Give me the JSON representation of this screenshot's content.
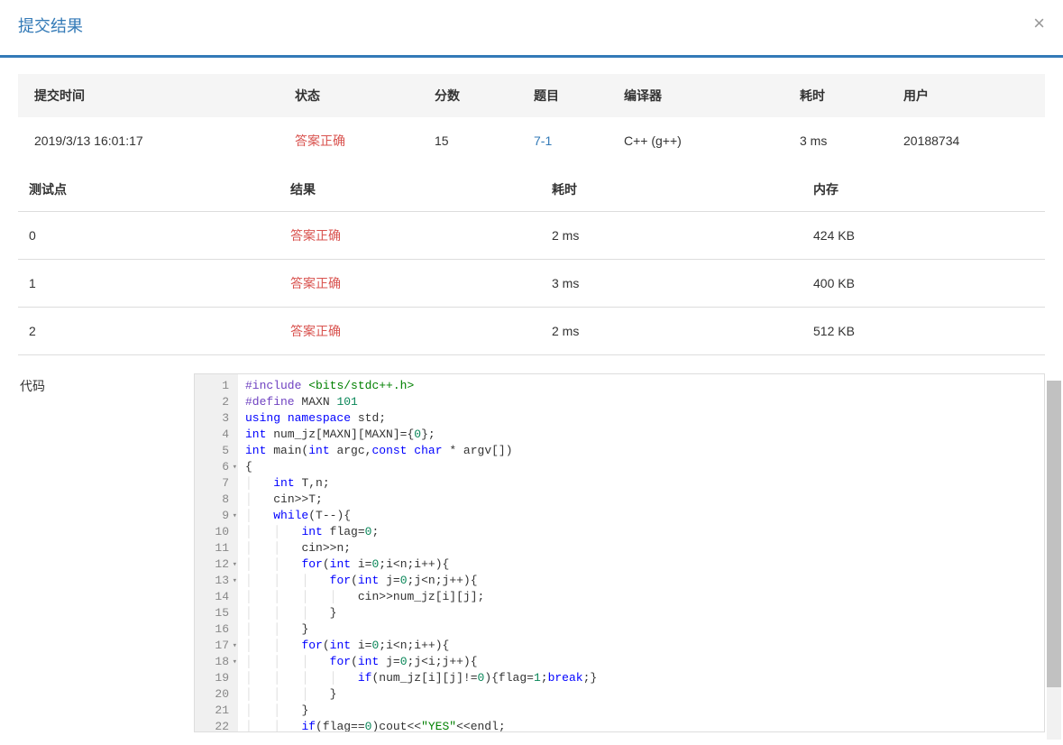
{
  "modal": {
    "title": "提交结果",
    "close_glyph": "×"
  },
  "submission_table": {
    "headers": [
      "提交时间",
      "状态",
      "分数",
      "题目",
      "编译器",
      "耗时",
      "用户"
    ],
    "row": {
      "time": "2019/3/13 16:01:17",
      "status": "答案正确",
      "score": "15",
      "problem": "7-1",
      "compiler": "C++ (g++)",
      "elapsed": "3 ms",
      "user": "20188734"
    }
  },
  "testcase_table": {
    "headers": [
      "测试点",
      "结果",
      "耗时",
      "内存"
    ],
    "rows": [
      {
        "id": "0",
        "result": "答案正确",
        "elapsed": "2 ms",
        "memory": "424 KB"
      },
      {
        "id": "1",
        "result": "答案正确",
        "elapsed": "3 ms",
        "memory": "400 KB"
      },
      {
        "id": "2",
        "result": "答案正确",
        "elapsed": "2 ms",
        "memory": "512 KB"
      }
    ]
  },
  "code": {
    "label": "代码",
    "lines": [
      {
        "n": 1,
        "fold": false,
        "tokens": [
          [
            "kw-pp",
            "#include"
          ],
          [
            "punct",
            " "
          ],
          [
            "str",
            "<bits/stdc++.h>"
          ]
        ]
      },
      {
        "n": 2,
        "fold": false,
        "tokens": [
          [
            "kw-pp",
            "#define"
          ],
          [
            "punct",
            " "
          ],
          [
            "ident",
            "MAXN "
          ],
          [
            "num",
            "101"
          ]
        ]
      },
      {
        "n": 3,
        "fold": false,
        "tokens": [
          [
            "kw-blue",
            "using"
          ],
          [
            "punct",
            " "
          ],
          [
            "kw-blue",
            "namespace"
          ],
          [
            "punct",
            " "
          ],
          [
            "ident",
            "std"
          ],
          [
            "punct",
            ";"
          ]
        ]
      },
      {
        "n": 4,
        "fold": false,
        "tokens": [
          [
            "kw-blue",
            "int"
          ],
          [
            "punct",
            " "
          ],
          [
            "ident",
            "num_jz[MAXN][MAXN]="
          ],
          [
            "punct",
            "{"
          ],
          [
            "num",
            "0"
          ],
          [
            "punct",
            "};"
          ]
        ]
      },
      {
        "n": 5,
        "fold": false,
        "tokens": [
          [
            "kw-blue",
            "int"
          ],
          [
            "punct",
            " "
          ],
          [
            "ident",
            "main("
          ],
          [
            "kw-blue",
            "int"
          ],
          [
            "punct",
            " "
          ],
          [
            "ident",
            "argc,"
          ],
          [
            "kw-blue",
            "const"
          ],
          [
            "punct",
            " "
          ],
          [
            "kw-blue",
            "char"
          ],
          [
            "punct",
            " * "
          ],
          [
            "ident",
            "argv[])"
          ]
        ]
      },
      {
        "n": 6,
        "fold": true,
        "tokens": [
          [
            "punct",
            "{"
          ]
        ]
      },
      {
        "n": 7,
        "fold": false,
        "tokens": [
          [
            "indent",
            "    "
          ],
          [
            "kw-blue",
            "int"
          ],
          [
            "punct",
            " "
          ],
          [
            "ident",
            "T,n;"
          ]
        ]
      },
      {
        "n": 8,
        "fold": false,
        "tokens": [
          [
            "indent",
            "    "
          ],
          [
            "ident",
            "cin>>T;"
          ]
        ]
      },
      {
        "n": 9,
        "fold": true,
        "tokens": [
          [
            "indent",
            "    "
          ],
          [
            "kw-blue",
            "while"
          ],
          [
            "punct",
            "(T--){"
          ]
        ]
      },
      {
        "n": 10,
        "fold": false,
        "tokens": [
          [
            "indent",
            "        "
          ],
          [
            "kw-blue",
            "int"
          ],
          [
            "punct",
            " "
          ],
          [
            "ident",
            "flag="
          ],
          [
            "num",
            "0"
          ],
          [
            "punct",
            ";"
          ]
        ]
      },
      {
        "n": 11,
        "fold": false,
        "tokens": [
          [
            "indent",
            "        "
          ],
          [
            "ident",
            "cin>>n;"
          ]
        ]
      },
      {
        "n": 12,
        "fold": true,
        "tokens": [
          [
            "indent",
            "        "
          ],
          [
            "kw-blue",
            "for"
          ],
          [
            "punct",
            "("
          ],
          [
            "kw-blue",
            "int"
          ],
          [
            "punct",
            " "
          ],
          [
            "ident",
            "i="
          ],
          [
            "num",
            "0"
          ],
          [
            "punct",
            ";i<n;i++){"
          ]
        ]
      },
      {
        "n": 13,
        "fold": true,
        "tokens": [
          [
            "indent",
            "            "
          ],
          [
            "kw-blue",
            "for"
          ],
          [
            "punct",
            "("
          ],
          [
            "kw-blue",
            "int"
          ],
          [
            "punct",
            " "
          ],
          [
            "ident",
            "j="
          ],
          [
            "num",
            "0"
          ],
          [
            "punct",
            ";j<n;j++){"
          ]
        ]
      },
      {
        "n": 14,
        "fold": false,
        "tokens": [
          [
            "indent",
            "                "
          ],
          [
            "ident",
            "cin>>num_jz[i][j];"
          ]
        ]
      },
      {
        "n": 15,
        "fold": false,
        "tokens": [
          [
            "indent",
            "            "
          ],
          [
            "punct",
            "}"
          ]
        ]
      },
      {
        "n": 16,
        "fold": false,
        "tokens": [
          [
            "indent",
            "        "
          ],
          [
            "punct",
            "}"
          ]
        ]
      },
      {
        "n": 17,
        "fold": true,
        "tokens": [
          [
            "indent",
            "        "
          ],
          [
            "kw-blue",
            "for"
          ],
          [
            "punct",
            "("
          ],
          [
            "kw-blue",
            "int"
          ],
          [
            "punct",
            " "
          ],
          [
            "ident",
            "i="
          ],
          [
            "num",
            "0"
          ],
          [
            "punct",
            ";i<n;i++){"
          ]
        ]
      },
      {
        "n": 18,
        "fold": true,
        "tokens": [
          [
            "indent",
            "            "
          ],
          [
            "kw-blue",
            "for"
          ],
          [
            "punct",
            "("
          ],
          [
            "kw-blue",
            "int"
          ],
          [
            "punct",
            " "
          ],
          [
            "ident",
            "j="
          ],
          [
            "num",
            "0"
          ],
          [
            "punct",
            ";j<i;j++){"
          ]
        ]
      },
      {
        "n": 19,
        "fold": false,
        "tokens": [
          [
            "indent",
            "                "
          ],
          [
            "kw-blue",
            "if"
          ],
          [
            "punct",
            "(num_jz[i][j]!="
          ],
          [
            "num",
            "0"
          ],
          [
            "punct",
            "){flag="
          ],
          [
            "num",
            "1"
          ],
          [
            "punct",
            ";"
          ],
          [
            "kw-blue",
            "break"
          ],
          [
            "punct",
            ";}"
          ]
        ]
      },
      {
        "n": 20,
        "fold": false,
        "tokens": [
          [
            "indent",
            "            "
          ],
          [
            "punct",
            "}"
          ]
        ]
      },
      {
        "n": 21,
        "fold": false,
        "tokens": [
          [
            "indent",
            "        "
          ],
          [
            "punct",
            "}"
          ]
        ]
      },
      {
        "n": 22,
        "fold": false,
        "tokens": [
          [
            "indent",
            "        "
          ],
          [
            "kw-blue",
            "if"
          ],
          [
            "punct",
            "(flag=="
          ],
          [
            "num",
            "0"
          ],
          [
            "punct",
            ")cout<<"
          ],
          [
            "str",
            "\"YES\""
          ],
          [
            "punct",
            "<<endl;"
          ]
        ]
      }
    ]
  }
}
